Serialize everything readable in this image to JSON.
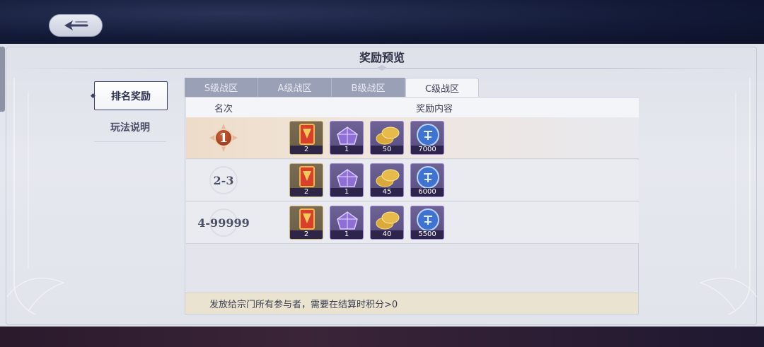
{
  "window": {
    "title": "奖励预览"
  },
  "back_button": {
    "icon": "back-arrow-icon"
  },
  "side_nav": {
    "items": [
      {
        "label": "排名奖励",
        "active": true
      },
      {
        "label": "玩法说明",
        "active": false
      }
    ]
  },
  "tabs": [
    {
      "label": "S级战区",
      "active": false
    },
    {
      "label": "A级战区",
      "active": false
    },
    {
      "label": "B级战区",
      "active": false
    },
    {
      "label": "C级战区",
      "active": true
    }
  ],
  "table": {
    "headers": {
      "rank": "名次",
      "rewards": "奖励内容"
    },
    "rows": [
      {
        "rank": "1",
        "rewards": [
          {
            "icon": "red-banner-token-icon",
            "count": "2"
          },
          {
            "icon": "purple-crystal-chest-icon",
            "count": "1"
          },
          {
            "icon": "gold-coins-icon",
            "count": "50"
          },
          {
            "icon": "blue-spirit-coin-icon",
            "count": "7000"
          }
        ]
      },
      {
        "rank": "2-3",
        "rewards": [
          {
            "icon": "red-banner-token-icon",
            "count": "2"
          },
          {
            "icon": "purple-crystal-chest-icon",
            "count": "1"
          },
          {
            "icon": "gold-coins-icon",
            "count": "45"
          },
          {
            "icon": "blue-spirit-coin-icon",
            "count": "6000"
          }
        ]
      },
      {
        "rank": "4-99999",
        "rewards": [
          {
            "icon": "red-banner-token-icon",
            "count": "2"
          },
          {
            "icon": "purple-crystal-chest-icon",
            "count": "1"
          },
          {
            "icon": "gold-coins-icon",
            "count": "40"
          },
          {
            "icon": "blue-spirit-coin-icon",
            "count": "5500"
          }
        ]
      }
    ]
  },
  "footer": {
    "note": "发放给宗门所有参与者，需要在结算时积分>0"
  },
  "colors": {
    "accent_dark": "#3a3f63",
    "tab_inactive": "#9aa0b5",
    "first_place_row": "#eedcc9",
    "footer_bg": "#e9e3cf"
  }
}
